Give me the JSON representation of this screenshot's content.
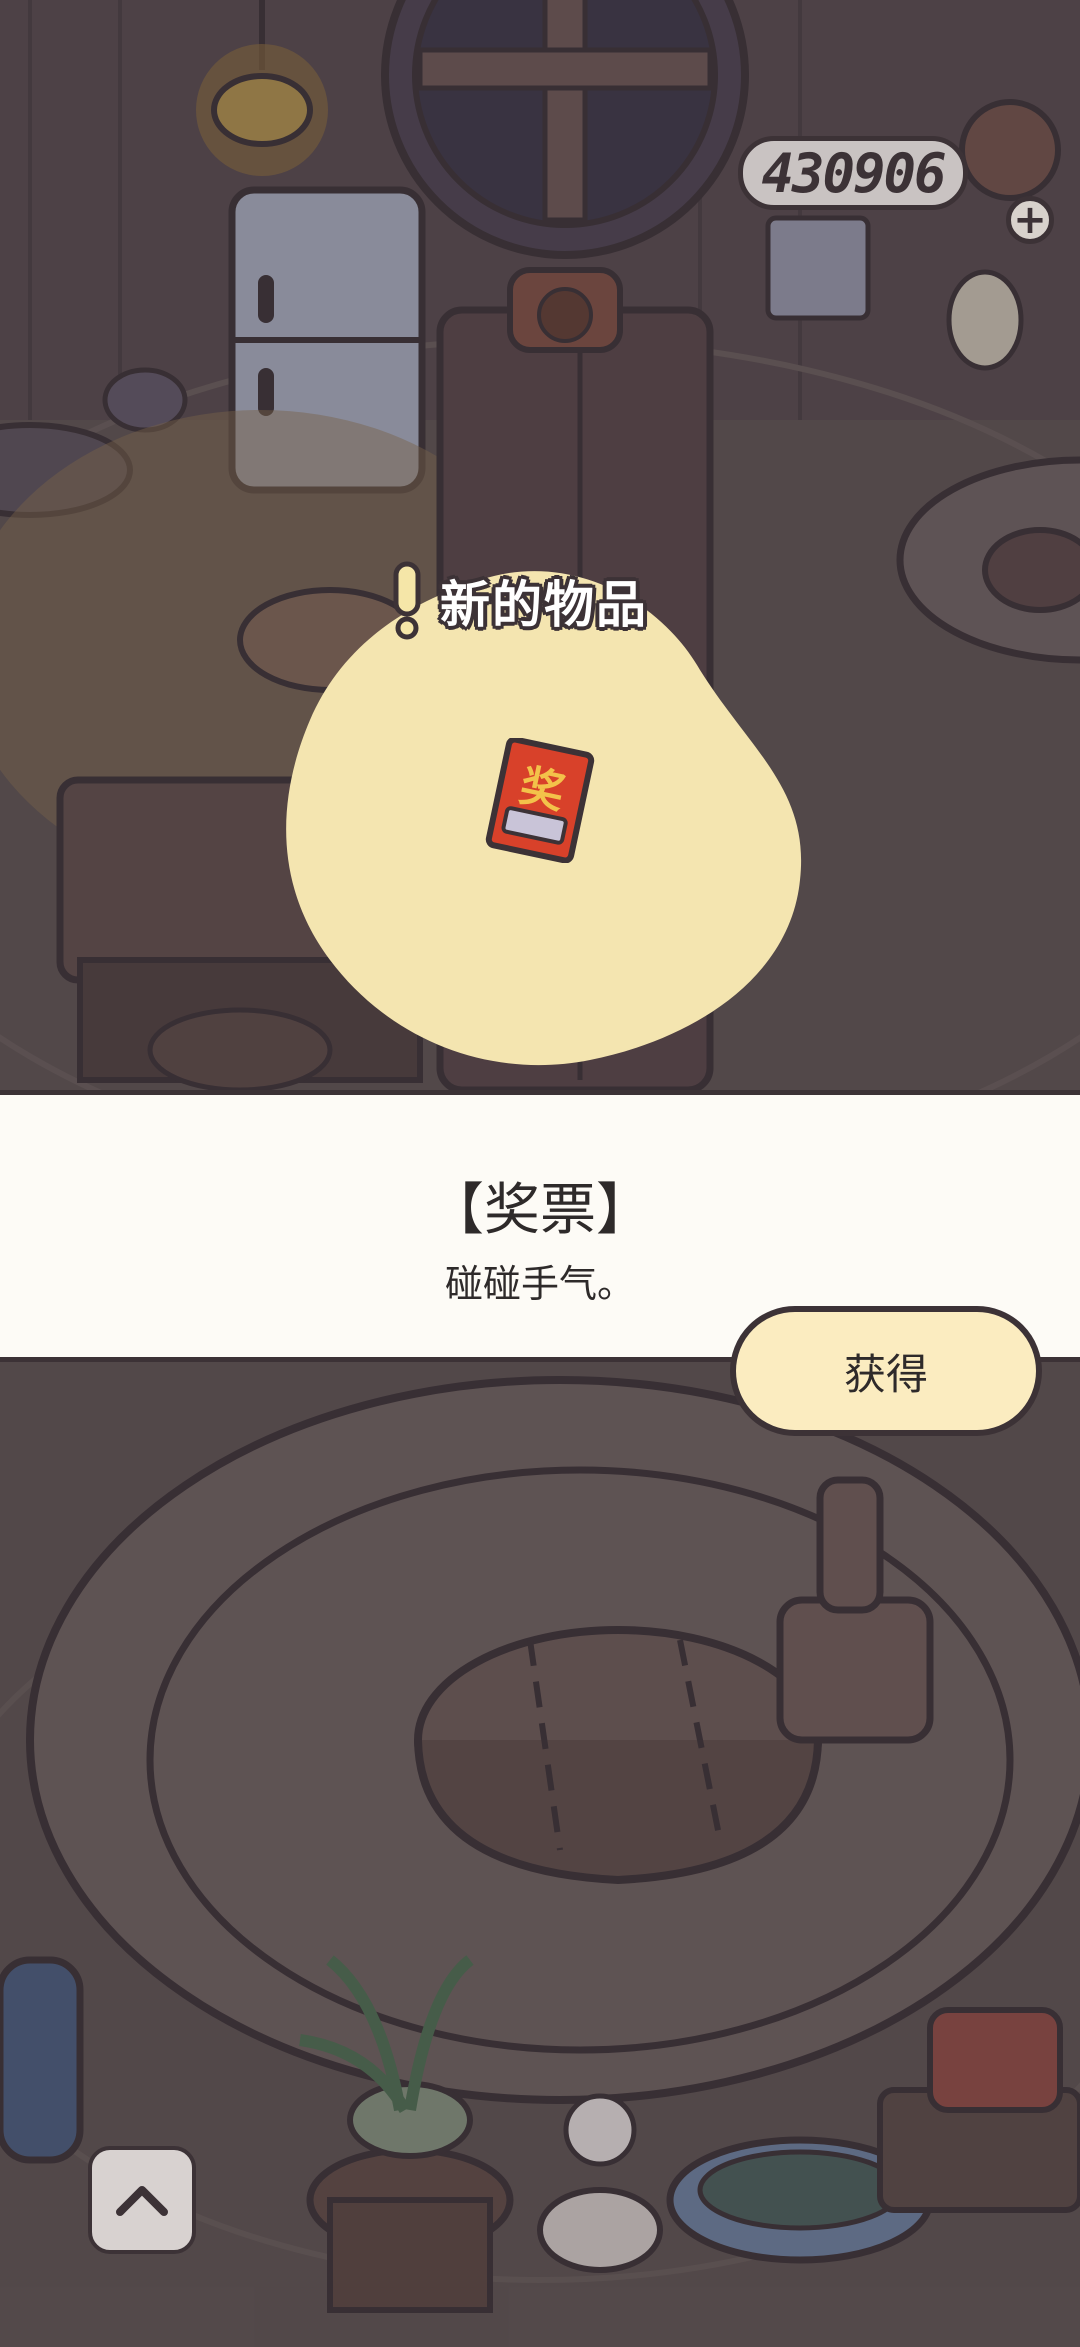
{
  "currency": {
    "value": "430906",
    "add_icon": "plus-icon"
  },
  "popup": {
    "header": "新的物品",
    "header_icon": "exclamation-icon",
    "item_icon": "lottery-ticket-icon",
    "item_glyph": "奖",
    "item_name": "【奖票】",
    "item_desc": "碰碰手气。",
    "obtain_label": "获得"
  },
  "nav": {
    "scroll_up_icon": "chevron-up-icon"
  },
  "colors": {
    "outline": "#3c3236",
    "panel_bg": "#fdfbf6",
    "button_bg": "#fbecc0",
    "glow": "#f7e9b6",
    "ticket_red": "#d8412a"
  }
}
